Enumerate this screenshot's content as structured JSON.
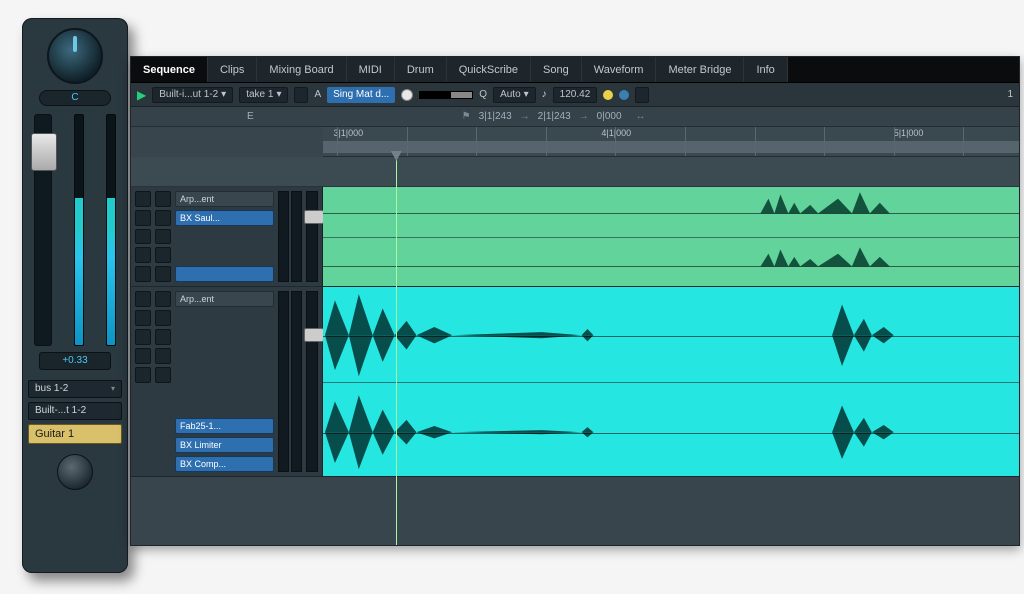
{
  "channel_strip": {
    "pan_value": "C",
    "db_readout": "+0.33",
    "routes": [
      {
        "label": "bus 1-2"
      },
      {
        "label": "Built-...t 1-2"
      }
    ],
    "track_name": "Guitar 1"
  },
  "tabs": [
    "Sequence",
    "Clips",
    "Mixing Board",
    "MIDI",
    "Drum",
    "QuickScribe",
    "Song",
    "Waveform",
    "Meter Bridge",
    "Info"
  ],
  "active_tab": "Sequence",
  "toolbar": {
    "output_sel": "Built-i...ut 1-2",
    "take_sel": "take 1",
    "a_label": "A",
    "selection_tool": "Sing Mat d...",
    "q_label": "Q",
    "auto_label": "Auto",
    "tempo": "120.42",
    "level": "1"
  },
  "secondbar": {
    "key": "E",
    "t1": "3|1|243",
    "t2": "2|1|243",
    "t3": "0|000"
  },
  "ruler": {
    "labels": [
      {
        "pos": 0.02,
        "text": "3|1|000"
      },
      {
        "pos": 0.4,
        "text": "4|1|000"
      },
      {
        "pos": 0.82,
        "text": "5|1|000"
      }
    ],
    "selection": {
      "start": 0.0,
      "end": 1.0
    },
    "playhead": 0.082
  },
  "tracks": [
    {
      "color": "green",
      "inserts": [
        {
          "label": "Arp...ent",
          "style": "gray"
        },
        {
          "label": "BX Saul...",
          "style": "blue"
        },
        {
          "label": "",
          "style": "blue"
        }
      ]
    },
    {
      "color": "cyan",
      "inserts": [
        {
          "label": "Arp...ent",
          "style": "gray"
        },
        {
          "label": "Fab25-1...",
          "style": "blue"
        },
        {
          "label": "BX Limiter",
          "style": "blue"
        },
        {
          "label": "BX Comp...",
          "style": "blue"
        }
      ]
    }
  ]
}
